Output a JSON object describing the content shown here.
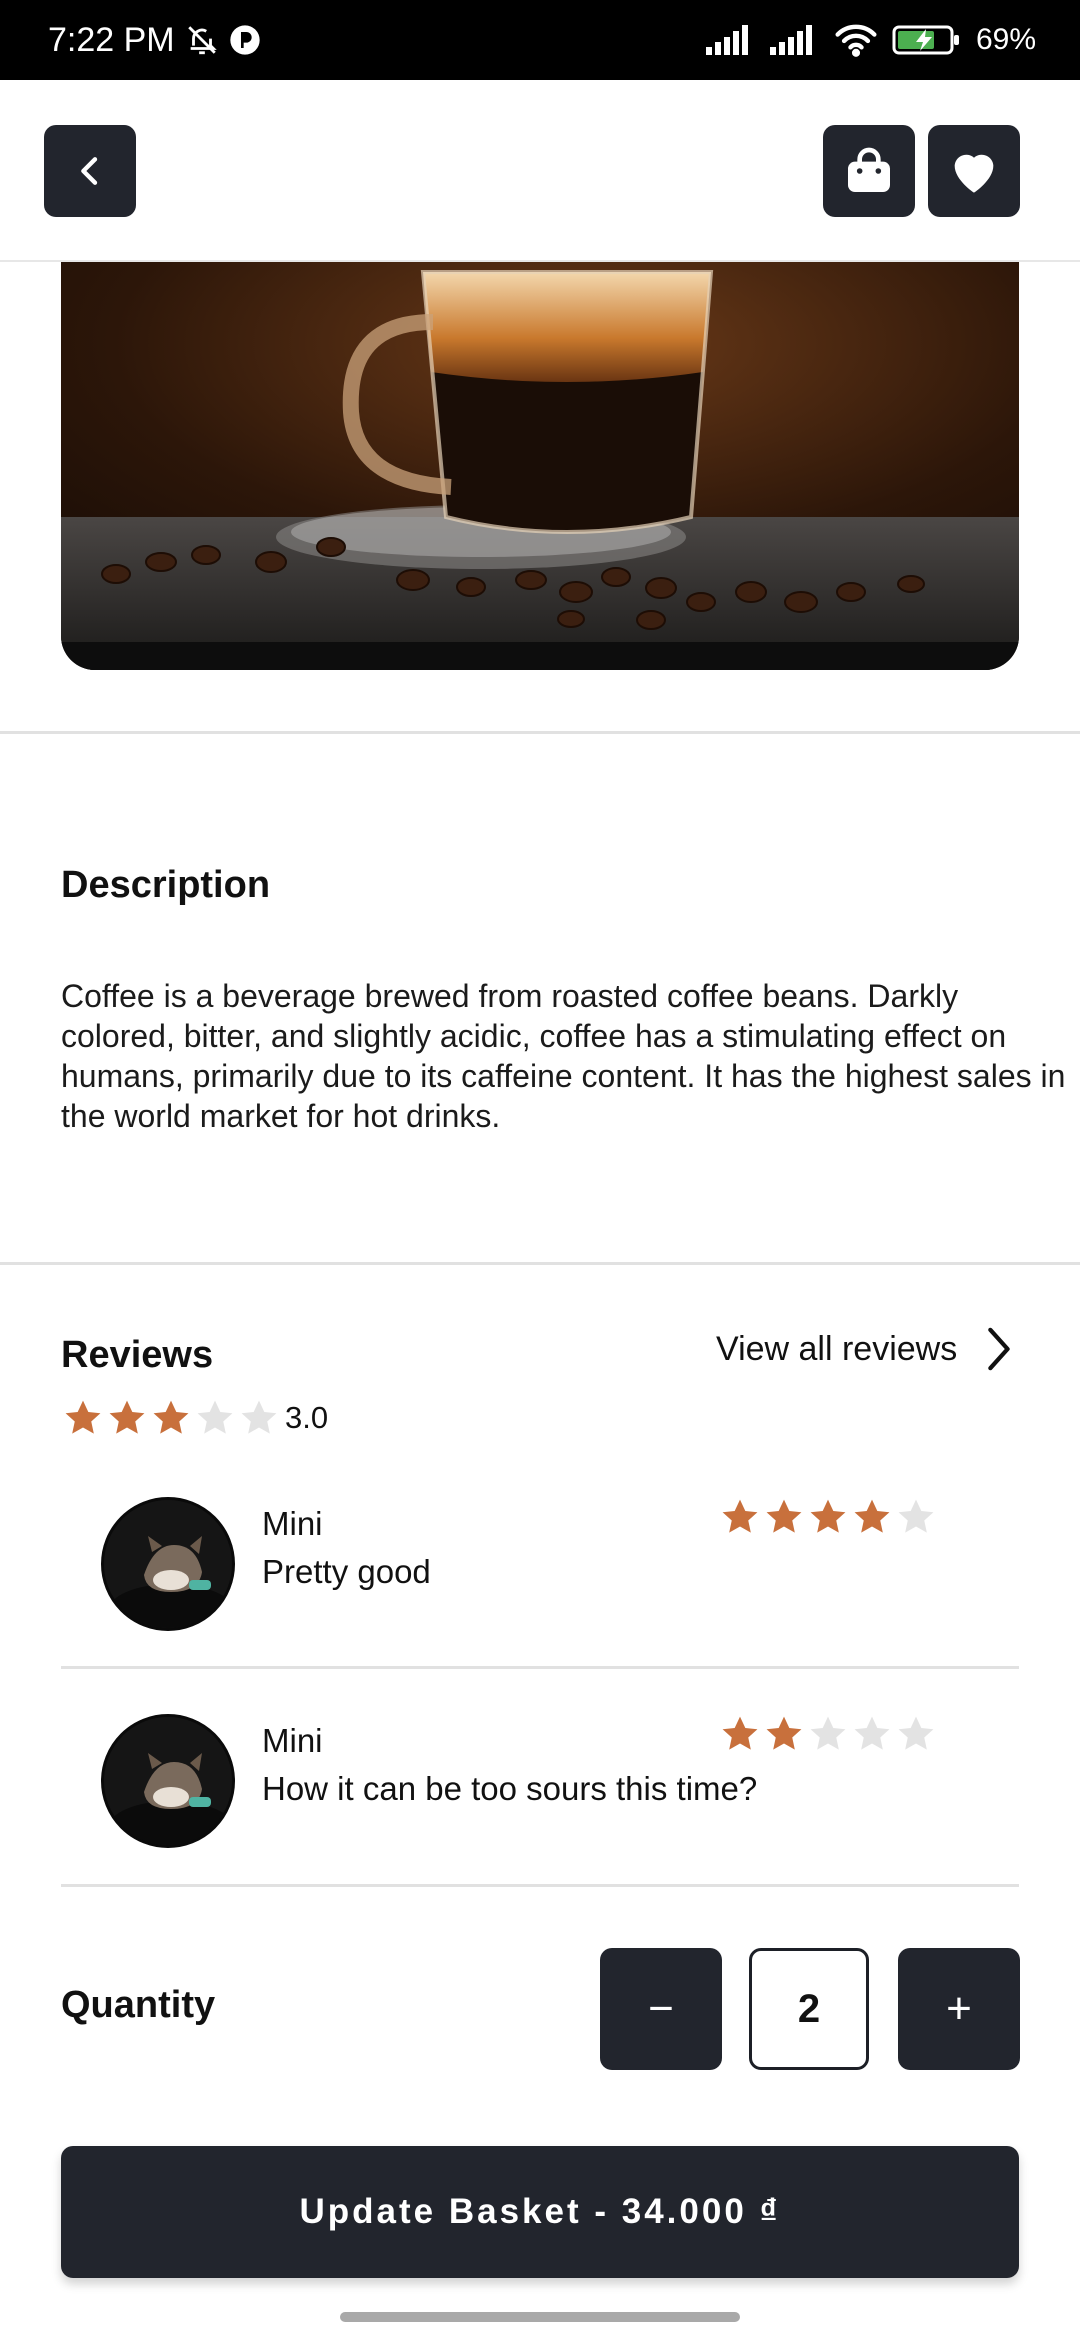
{
  "status_bar": {
    "time": "7:22 PM",
    "battery": "69%",
    "icons": [
      "bell-off-icon",
      "app-badge-icon",
      "signal-icon",
      "signal-icon",
      "wifi-icon",
      "battery-charging-icon"
    ]
  },
  "top_bar": {
    "back_icon": "chevron-left-icon",
    "basket_icon": "shopping-bag-icon",
    "favorite_icon": "heart-icon"
  },
  "description": {
    "title": "Description",
    "text": "Coffee is a beverage brewed from roasted coffee beans. Darkly colored, bitter, and slightly acidic, coffee has a stimulating effect on humans, primarily due to its caffeine content. It has the highest sales in the world market for hot drinks."
  },
  "reviews": {
    "title": "Reviews",
    "view_all_label": "View all reviews",
    "average_rating": 3,
    "average_rating_text": "3.0",
    "items": [
      {
        "name": "Mini",
        "text": "Pretty good",
        "rating": 4
      },
      {
        "name": "Mini",
        "text": "How it can be too sours this time?",
        "rating": 2
      }
    ]
  },
  "quantity": {
    "label": "Quantity",
    "minus_label": "−",
    "value": "2",
    "plus_label": "+"
  },
  "update_button": {
    "label": "Update Basket - 34.000 ₫"
  },
  "colors": {
    "dark": "#22252d",
    "star_filled": "#c8703c",
    "star_empty": "#e3e3e3"
  }
}
